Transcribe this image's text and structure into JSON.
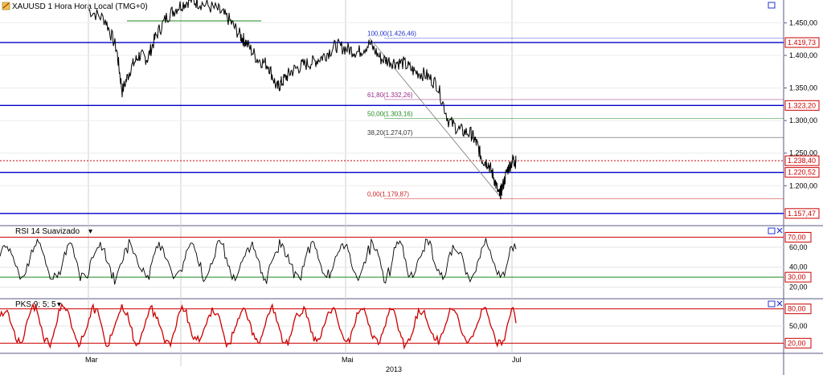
{
  "window": {
    "title": "XAUUSD 1 Hora Hora Local (TMG+0)",
    "colors": {
      "grid": "#cfcfcf",
      "axis": "#5a5a8a",
      "hline": "#0000cc",
      "tag": "#cc0000",
      "price": "#000000",
      "pks": "#cc0000"
    }
  },
  "chart_data": [
    {
      "type": "line",
      "name": "main-price",
      "title": "XAUUSD 1 Hora Hora Local (TMG+0)",
      "y_ticks": [
        "1.450,00",
        "1.400,00",
        "1.350,00",
        "1.300,00",
        "1.250,00",
        "1.200,00"
      ],
      "ylim": [
        1140,
        1485
      ],
      "horizontal_levels": [
        {
          "label": "1.419,73",
          "value": 1419.73
        },
        {
          "label": "1.323,20",
          "value": 1323.2
        },
        {
          "label": "1.220,52",
          "value": 1220.52
        },
        {
          "label": "1.157,47",
          "value": 1157.47
        }
      ],
      "current_price": {
        "label": "1.238,40",
        "value": 1238.4
      },
      "fibonacci": [
        {
          "label": "100,00(1.426,46)",
          "value": 1426.46,
          "color": "#2233cc"
        },
        {
          "label": "61,80(1.332,26)",
          "value": 1332.26,
          "color": "#9a2a8a"
        },
        {
          "label": "50,00(1.303,16)",
          "value": 1303.16,
          "color": "#1e8a1e"
        },
        {
          "label": "38,20(1.274,07)",
          "value": 1274.07,
          "color": "#333333"
        },
        {
          "label": "0,00(1.179,87)",
          "value": 1179.87,
          "color": "#cc2222"
        }
      ],
      "price_path": [
        [
          0,
          1470
        ],
        [
          0.03,
          1455
        ],
        [
          0.05,
          1410
        ],
        [
          0.06,
          1345
        ],
        [
          0.075,
          1380
        ],
        [
          0.09,
          1400
        ],
        [
          0.105,
          1395
        ],
        [
          0.12,
          1430
        ],
        [
          0.14,
          1460
        ],
        [
          0.16,
          1475
        ],
        [
          0.18,
          1485
        ],
        [
          0.2,
          1480
        ],
        [
          0.23,
          1470
        ],
        [
          0.25,
          1455
        ],
        [
          0.27,
          1430
        ],
        [
          0.28,
          1420
        ],
        [
          0.3,
          1395
        ],
        [
          0.32,
          1385
        ],
        [
          0.335,
          1350
        ],
        [
          0.345,
          1360
        ],
        [
          0.36,
          1375
        ],
        [
          0.38,
          1385
        ],
        [
          0.4,
          1390
        ],
        [
          0.42,
          1400
        ],
        [
          0.44,
          1415
        ],
        [
          0.46,
          1410
        ],
        [
          0.48,
          1405
        ],
        [
          0.5,
          1418
        ],
        [
          0.52,
          1395
        ],
        [
          0.54,
          1390
        ],
        [
          0.56,
          1388
        ],
        [
          0.58,
          1375
        ],
        [
          0.6,
          1370
        ],
        [
          0.62,
          1355
        ],
        [
          0.64,
          1300
        ],
        [
          0.66,
          1285
        ],
        [
          0.68,
          1280
        ],
        [
          0.69,
          1265
        ],
        [
          0.7,
          1240
        ],
        [
          0.71,
          1235
        ],
        [
          0.72,
          1215
        ],
        [
          0.73,
          1185
        ],
        [
          0.735,
          1195
        ],
        [
          0.745,
          1225
        ],
        [
          0.755,
          1240
        ],
        [
          0.76,
          1236
        ]
      ],
      "x_labels": [
        "Mar",
        "Mai",
        "Jul",
        "2013"
      ]
    },
    {
      "type": "line",
      "name": "rsi",
      "title": "RSI 14 Suavizado",
      "ylim": [
        10,
        80
      ],
      "y_ticks": [
        "60,00",
        "40,00",
        "20,00"
      ],
      "level_tags": [
        {
          "label": "70,00",
          "value": 70
        },
        {
          "label": "30,00",
          "value": 30
        }
      ],
      "seed": 17,
      "base": 46,
      "amp": 22,
      "last": 58
    },
    {
      "type": "line",
      "name": "pks",
      "title": "PKS 9; 5; 5",
      "ylim": [
        5,
        95
      ],
      "y_ticks": [
        "50,00"
      ],
      "level_tags": [
        {
          "label": "80,00",
          "value": 80
        },
        {
          "label": "20,00",
          "value": 20
        }
      ],
      "seed": 91,
      "base": 50,
      "amp": 38,
      "last": 55
    }
  ],
  "panes": {
    "rsi_title": "RSI 14 Suavizado",
    "rsi_menu": "▾",
    "pks_title": "PKS 9; 5; 5",
    "pks_menu": "▾"
  }
}
